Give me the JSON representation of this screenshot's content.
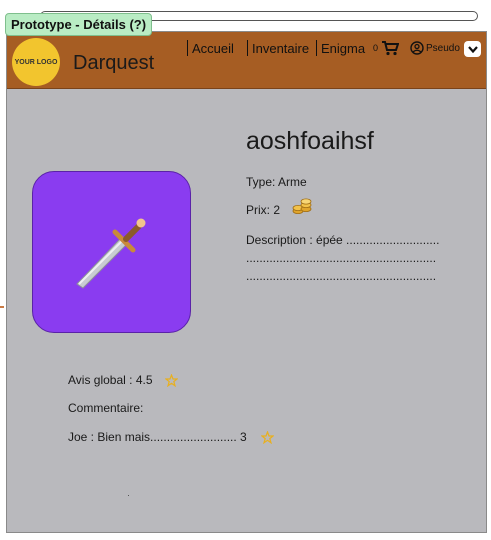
{
  "prototype_tag": "Prototype - Détails (?)",
  "header": {
    "logo_text": "YOUR LOGO",
    "brand": "Darquest",
    "nav": [
      "Accueil",
      "Inventaire",
      "Enigma"
    ],
    "cart_count": "0",
    "user_label": "Pseudo",
    "accent": "#a65d23"
  },
  "item": {
    "name": "aoshfoaihsf",
    "type": "Type: Arme",
    "price": "Prix: 2",
    "description": "Description : épée ............................",
    "desc_line2": ".........................................................",
    "desc_line3": "........................................................."
  },
  "reviews": {
    "global": "Avis global : 4.5",
    "comment_label": "Commentaire:",
    "comment": "Joe :  Bien mais..........................  3"
  },
  "icons": [
    "cart-icon",
    "user-icon",
    "chevron-down-icon",
    "sword-icon",
    "coins-icon",
    "star-icon"
  ]
}
